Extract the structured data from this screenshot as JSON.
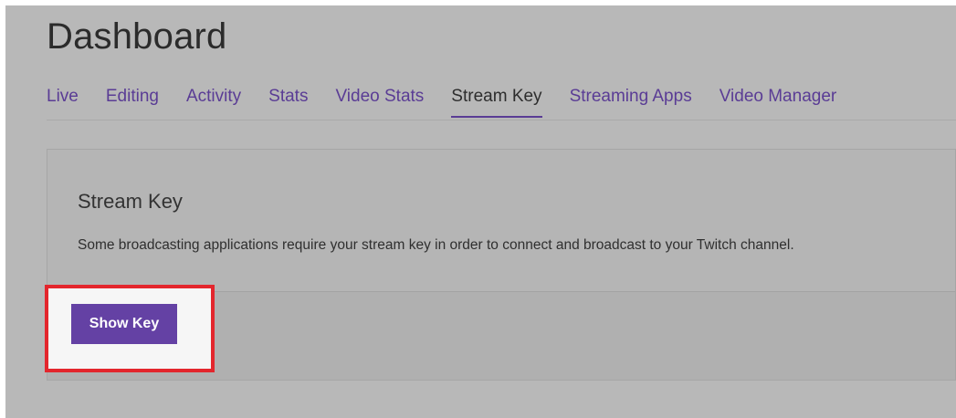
{
  "page": {
    "title": "Dashboard"
  },
  "tabs": [
    {
      "label": "Live",
      "active": false
    },
    {
      "label": "Editing",
      "active": false
    },
    {
      "label": "Activity",
      "active": false
    },
    {
      "label": "Stats",
      "active": false
    },
    {
      "label": "Video Stats",
      "active": false
    },
    {
      "label": "Stream Key",
      "active": true
    },
    {
      "label": "Streaming Apps",
      "active": false
    },
    {
      "label": "Video Manager",
      "active": false
    }
  ],
  "stream_key": {
    "heading": "Stream Key",
    "description": "Some broadcasting applications require your stream key in order to connect and broadcast to your Twitch channel.",
    "show_key_label": "Show Key"
  },
  "colors": {
    "accent": "#6441a4",
    "highlight": "#e3262d"
  }
}
